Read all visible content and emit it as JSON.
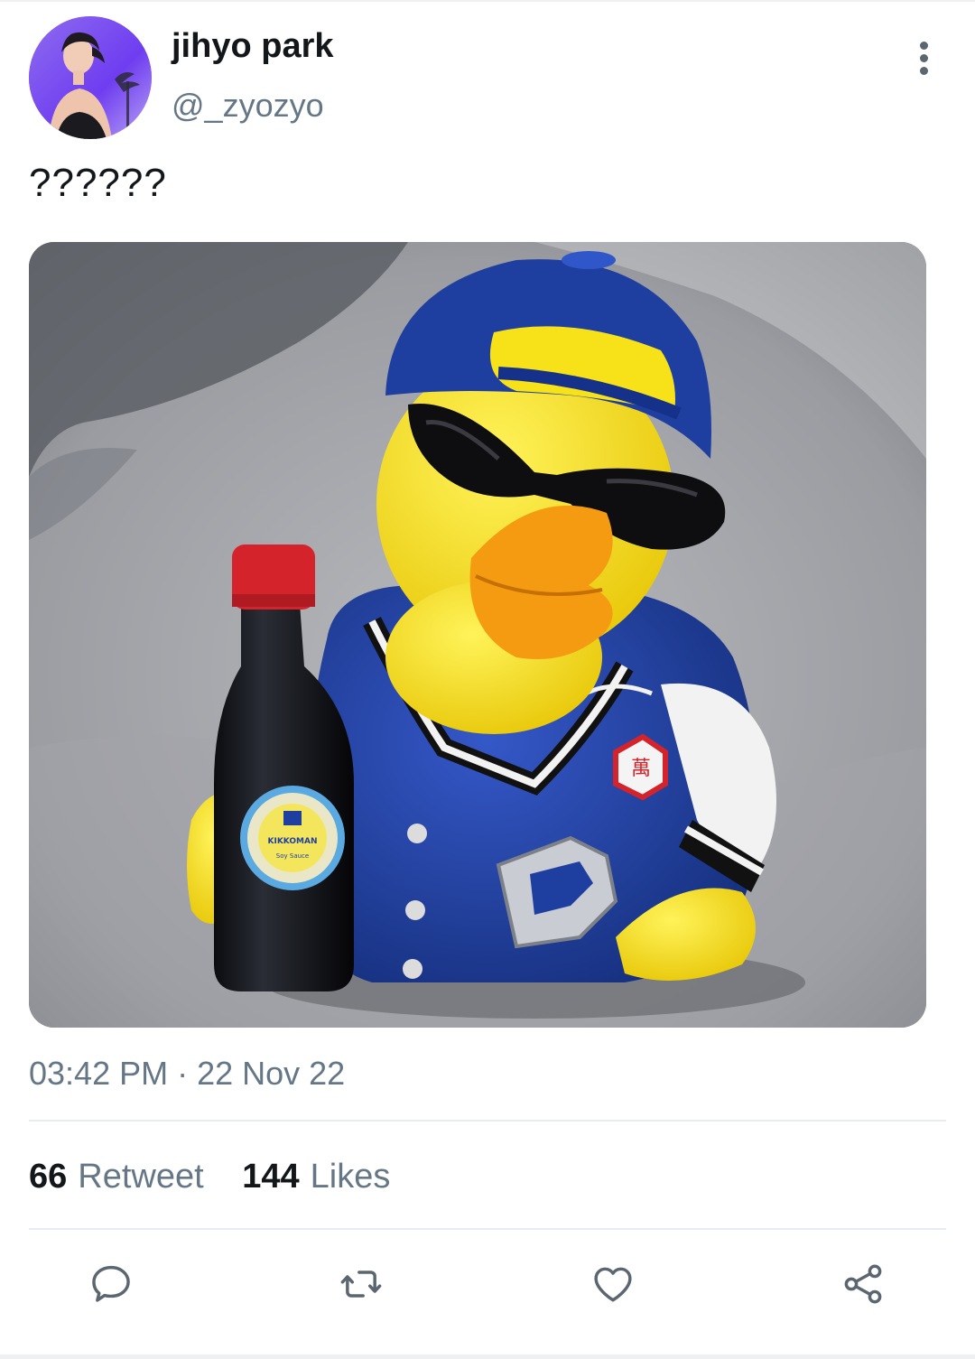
{
  "tweet": {
    "author": {
      "display_name": "jihyo park",
      "handle": "@_zyozyo"
    },
    "text": "??????",
    "media": {
      "label_text": "KIKKOMAN",
      "label_subtext": "Soy Sauce",
      "colors": {
        "duck": "#f7e21a",
        "jacket": "#1e3fa0",
        "beak": "#f59b12",
        "bottle_cap": "#d4232a"
      }
    },
    "time": "03:42 PM",
    "separator": "·",
    "date": "22 Nov 22",
    "retweet_count": "66",
    "retweet_label": "Retweet",
    "like_count": "144",
    "like_label": "Likes"
  },
  "icons": {
    "more": "more-vertical-icon",
    "reply": "reply-icon",
    "retweet": "retweet-icon",
    "like": "heart-icon",
    "share": "share-icon"
  },
  "colors": {
    "text_primary": "#14171a",
    "text_secondary": "#657786",
    "icon": "#5b6670",
    "divider": "#e6ecf0"
  }
}
